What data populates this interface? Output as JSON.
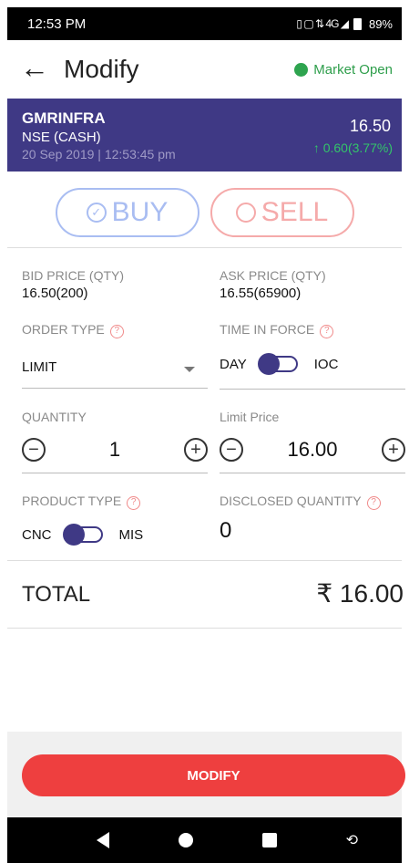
{
  "status_bar": {
    "time": "12:53 PM",
    "signal_icons": "▯ ▢ ⇅ 4G ◢",
    "battery": "89%"
  },
  "header": {
    "back_icon": "back-arrow-icon",
    "title": "Modify",
    "market_status": "Market Open",
    "market_color": "#2ea44f"
  },
  "stock": {
    "symbol": "GMRINFRA",
    "exchange": "NSE (CASH)",
    "timestamp": "20 Sep 2019 | 12:53:45 pm",
    "price": "16.50",
    "change": "↑ 0.60(3.77%)",
    "banner_color": "#3f3985"
  },
  "sides": {
    "buy_label": "BUY",
    "sell_label": "SELL",
    "buy_color": "#a9bdf2",
    "sell_color": "#f5aaaa"
  },
  "quotes": {
    "bid_label": "BID PRICE (QTY)",
    "bid_value": "16.50(200)",
    "ask_label": "ASK PRICE (QTY)",
    "ask_value": "16.55(65900)"
  },
  "order_type": {
    "label": "ORDER TYPE",
    "help": "?",
    "value": "LIMIT"
  },
  "time_in_force": {
    "label": "TIME IN FORCE",
    "help": "?",
    "left": "DAY",
    "right": "IOC"
  },
  "quantity": {
    "label": "QUANTITY",
    "value": "1",
    "minus": "−",
    "plus": "+"
  },
  "limit_price": {
    "label": "Limit Price",
    "value": "16.00",
    "minus": "−",
    "plus": "+"
  },
  "product_type": {
    "label": "PRODUCT TYPE",
    "help": "?",
    "left": "CNC",
    "right": "MIS"
  },
  "disclosed": {
    "label": "DISCLOSED QUANTITY",
    "help": "?",
    "value": "0"
  },
  "total": {
    "label": "TOTAL",
    "value": "₹ 16.00"
  },
  "actions": {
    "modify_label": "MODIFY",
    "modify_color": "#ee3f3f"
  }
}
